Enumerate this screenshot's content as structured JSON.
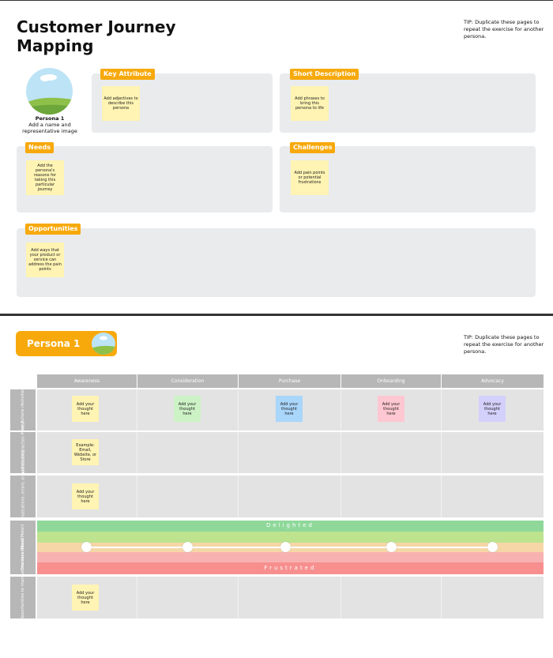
{
  "page1": {
    "title_line1": "Customer Journey",
    "title_line2": "Mapping",
    "tip": "TIP: Duplicate these pages to repeat the exercise for another persona.",
    "persona_name": "Persona 1",
    "persona_desc": "Add a name and representative image",
    "sections": {
      "key_attribute": {
        "label": "Key Attribute",
        "note": "Add adjectives to describe this persona"
      },
      "short_description": {
        "label": "Short Description",
        "note": "Add phrases to bring this persona to life"
      },
      "needs": {
        "label": "Needs",
        "note": "Add the persona's reasons for taking this particular journey"
      },
      "challenges": {
        "label": "Challenges",
        "note": "Add pain points or potential frustrations"
      },
      "opportunities": {
        "label": "Opportunities",
        "note": "Add ways that your product or service can address the pain points"
      }
    }
  },
  "page2": {
    "persona_pill": "Persona 1",
    "tip": "TIP: Duplicate these pages to repeat the exercise for another persona.",
    "stages": [
      "Awareness",
      "Consideration",
      "Purchase",
      "Onboarding",
      "Advocacy"
    ],
    "rows": {
      "user_actions": "User Actions (Activities)",
      "touchpoints": "Touchpoints (Interaction Points)",
      "pain_points": "Pain points (frustrations, errors, or bottlenecks)",
      "emotions": "Emotions (Mood Meter)",
      "possible_solutions": "Possible Solutions (Opportunities to improve the experience)"
    },
    "notes": {
      "thought": "Add your thought here",
      "touchpoint_example": "Example: Email, Website, or Store"
    },
    "emotion_top": "Delighted",
    "emotion_bottom": "Frustrated",
    "colors": {
      "accent": "#f7a90c",
      "sticky_yellow": "#fff4b3",
      "sticky_green": "#cdf2c6",
      "sticky_blue": "#a9d6fb",
      "sticky_pink": "#ffc7d1",
      "sticky_lavender": "#d3d0fb",
      "band_green": "#8fd89a",
      "band_lime": "#bde38f",
      "band_peach": "#f6d6a6",
      "band_pink": "#f8b1b1",
      "band_red": "#f78f8f"
    }
  }
}
